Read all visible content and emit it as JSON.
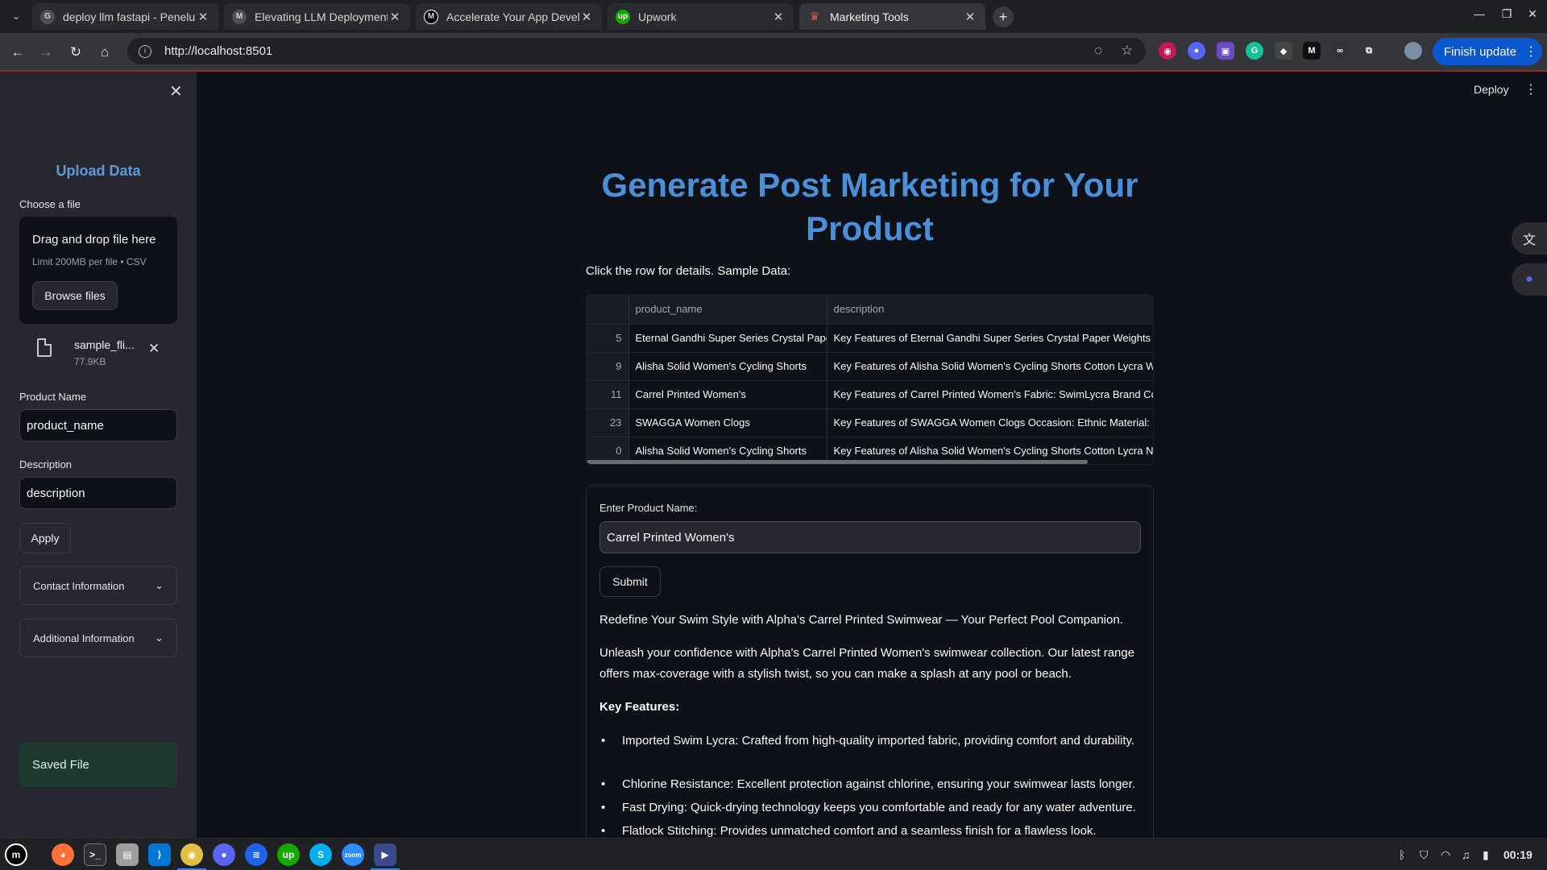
{
  "browser": {
    "tabs": [
      {
        "title": "deploy llm fastapi - Penelusu",
        "favicon": "G",
        "color": "#4f4f4f"
      },
      {
        "title": "Elevating LLM Deployment w",
        "favicon": "M",
        "color": "#4f4f4f"
      },
      {
        "title": "Accelerate Your App Develo",
        "favicon": "M",
        "color": "#000000"
      },
      {
        "title": "Upwork",
        "favicon": "up",
        "color": "#14a800"
      },
      {
        "title": "Marketing Tools",
        "favicon": "S",
        "color": "#ff4b4b"
      }
    ],
    "url": "http://localhost:8501",
    "finish_update_label": "Finish update"
  },
  "sidebar": {
    "title": "Upload Data",
    "file_label": "Choose a file",
    "dropzone_main": "Drag and drop file here",
    "dropzone_sub": "Limit 200MB per file • CSV",
    "browse_label": "Browse files",
    "file_name": "sample_fli...",
    "file_size": "77.9KB",
    "product_name_label": "Product Name",
    "product_name_value": "product_name",
    "description_label": "Description",
    "description_value": "description",
    "apply_label": "Apply",
    "expanders": [
      "Contact Information",
      "Additional Information"
    ],
    "saved_label": "Saved File"
  },
  "header": {
    "deploy_label": "Deploy"
  },
  "main": {
    "title": "Generate Post Marketing for Your Product",
    "caption": "Click the row for details. Sample Data:",
    "table": {
      "columns": [
        "",
        "product_name",
        "description"
      ],
      "rows": [
        [
          "5",
          "Eternal Gandhi Super Series Crystal Paper Weights",
          "Key Features of Eternal Gandhi Super Series Crystal Paper Weights  with Silver Finish"
        ],
        [
          "9",
          "Alisha Solid Women's Cycling Shorts",
          "Key Features of Alisha Solid Women's Cycling Shorts Cotton Lycra White"
        ],
        [
          "11",
          "Carrel Printed Women's",
          "Key Features of Carrel Printed Women's Fabric: SwimLycra Brand Color"
        ],
        [
          "23",
          "SWAGGA Women Clogs",
          "Key Features of SWAGGA Women Clogs Occasion: Ethnic Material: Leather"
        ],
        [
          "0",
          "Alisha Solid Women's Cycling Shorts",
          "Key Features of Alisha Solid Women's Cycling Shorts Cotton Lycra Navy"
        ]
      ]
    },
    "form": {
      "label": "Enter Product Name:",
      "value": "Carrel Printed Women's",
      "submit_label": "Submit"
    },
    "output": {
      "headline": "Redefine Your Swim Style with Alpha's Carrel Printed Swimwear — Your Perfect Pool Companion.",
      "intro": "Unleash your confidence with Alpha's Carrel Printed Women's swimwear collection. Our latest range offers max-coverage with a stylish twist, so you can make a splash at any pool or beach.",
      "features_heading": "Key Features:",
      "features": [
        "Imported Swim Lycra: Crafted from high-quality imported fabric, providing comfort and durability.",
        "Chlorine Resistance: Excellent protection against chlorine, ensuring your swimwear lasts longer.",
        "Fast Drying: Quick-drying technology keeps you comfortable and ready for any water adventure.",
        "Flatlock Stitching: Provides unmatched comfort and a seamless finish for a flawless look."
      ]
    }
  },
  "taskbar": {
    "apps": [
      "mint-menu",
      "firefox",
      "terminal",
      "files",
      "vscode",
      "chrome",
      "discord",
      "docker",
      "upwork",
      "skype",
      "zoom",
      "screen-recorder"
    ],
    "clock": "00:19"
  }
}
